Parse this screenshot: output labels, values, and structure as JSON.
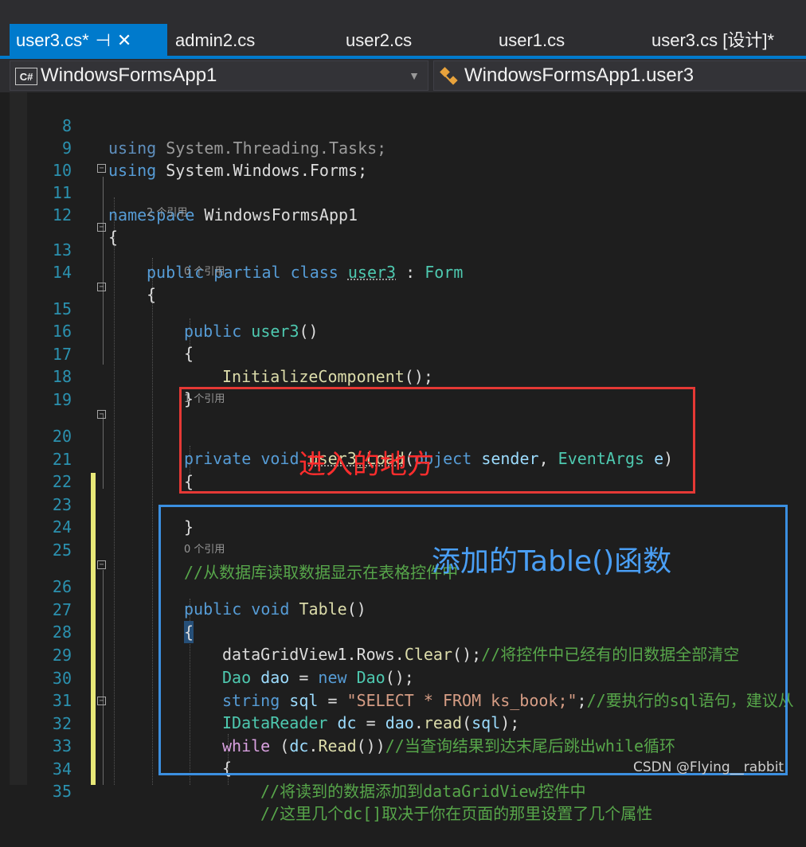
{
  "tabs": [
    {
      "label": "user3.cs*",
      "active": true
    },
    {
      "label": "admin2.cs"
    },
    {
      "label": "user2.cs"
    },
    {
      "label": "user1.cs"
    },
    {
      "label": "user3.cs [设计]*"
    }
  ],
  "icons": {
    "pin": "⊣",
    "close": "✕"
  },
  "nav": {
    "project_icon": "C#",
    "project": "WindowsFormsApp1",
    "class": "WindowsFormsApp1.user3"
  },
  "line_numbers": [
    "8",
    "9",
    "10",
    "11",
    "12",
    "13",
    "14",
    "15",
    "16",
    "17",
    "18",
    "19",
    "20",
    "21",
    "22",
    "23",
    "24",
    "25",
    "26",
    "27",
    "28",
    "29",
    "30",
    "31",
    "32",
    "33",
    "34",
    "35"
  ],
  "codelens": {
    "class": "2 个引用",
    "ctor": "0 个引用",
    "load": "1 个引用",
    "table": "0 个引用"
  },
  "code": {
    "l8": [
      "using",
      " System.Threading.Tasks;"
    ],
    "l9": [
      "using",
      " System.Windows.Forms;"
    ],
    "l11": [
      "namespace",
      " WindowsFormsApp1"
    ],
    "l12": "{",
    "l13": [
      "public partial class",
      " ",
      "user3",
      " : ",
      "Form"
    ],
    "l14": "{",
    "l15": [
      "public",
      " ",
      "user3",
      "()"
    ],
    "l16": "{",
    "l17": [
      "InitializeComponent",
      "();"
    ],
    "l18": "}",
    "l20": [
      "private void",
      " ",
      "user3_Load",
      "(",
      "object",
      " ",
      "sender",
      ", ",
      "EventArgs",
      " ",
      "e",
      ")"
    ],
    "l21": "{",
    "l23": "}",
    "l25": "//从数据库读取数据显示在表格控件中",
    "l26": [
      "public void",
      " ",
      "Table",
      "()"
    ],
    "l27": "{",
    "l28": [
      "dataGridView1",
      ".",
      "Rows",
      ".",
      "Clear",
      "();",
      "//将控件中已经有的旧数据全部清空"
    ],
    "l29": [
      "Dao",
      " ",
      "dao",
      " = ",
      "new",
      " ",
      "Dao",
      "();"
    ],
    "l30": [
      "string",
      " ",
      "sql",
      " = ",
      "\"SELECT * FROM ks_book;\"",
      ";",
      "//要执行的sql语句，建议从"
    ],
    "l31": [
      "IDataReader",
      " ",
      "dc",
      " = ",
      "dao",
      ".",
      "read",
      "(",
      "sql",
      ");"
    ],
    "l32": [
      "while",
      " (",
      "dc",
      ".",
      "Read",
      "())",
      "//当查询结果到达末尾后跳出while循环"
    ],
    "l33": "{",
    "l34": "//将读到的数据添加到dataGridView控件中",
    "l35": "//这里几个dc[]取决于你在页面的那里设置了几个属性"
  },
  "annotations": {
    "red": "进入的地方",
    "blue": "添加的Table()函数"
  },
  "watermark": "CSDN @Flying__rabbit"
}
